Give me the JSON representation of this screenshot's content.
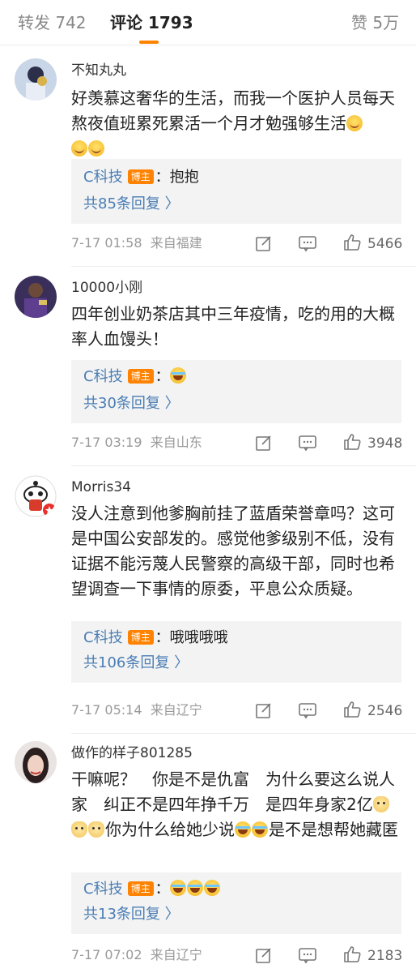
{
  "tabs": {
    "repost": "转发 742",
    "comments": "评论 1793",
    "likes": "赞 5万"
  },
  "accent_color": "#ff8200",
  "link_color": "#4a7db4",
  "comments": [
    {
      "username": "不知丸丸",
      "text": "好羡慕这奢华的生活，而我一个医护人员每天熬夜值班累死累活一个月才勉强够生活",
      "emoji": [
        "loudly-crying-face",
        "loudly-crying-face",
        "loudly-crying-face"
      ],
      "reply": {
        "author": "C科技",
        "badge": "博主",
        "text": "：抱抱",
        "count": "共85条回复 〉"
      },
      "time": "7-17 01:58",
      "location": "来自福建",
      "likes": "5466"
    },
    {
      "username": "10000小刚",
      "text": "四年创业奶茶店其中三年疫情，吃的用的大概率人血馒头！",
      "reply": {
        "author": "C科技",
        "badge": "博主",
        "text": "：",
        "emoji": [
          "laughing-crying-face"
        ],
        "count": "共30条回复 〉"
      },
      "time": "7-17 03:19",
      "location": "来自山东",
      "likes": "3948"
    },
    {
      "username": "Morris34",
      "text": "没人注意到他爹胸前挂了蓝盾荣誉章吗？这可是中国公安部发的。感觉他爹级别不低，没有证据不能污蔑人民警察的高级干部，同时也希望调查一下事情的原委，平息公众质疑。",
      "reply": {
        "author": "C科技",
        "badge": "博主",
        "text": "：哦哦哦哦",
        "count": "共106条回复 〉"
      },
      "time": "7-17 05:14",
      "location": "来自辽宁",
      "likes": "2546"
    },
    {
      "username": "做作的样子801285",
      "text_part1": "干嘛呢？　你是不是仇富　为什么要这么说人家　纠正不是四年挣千万　是四年身家2亿",
      "text_part2": "你为什么给她少说",
      "text_part3": "是不是想帮她藏匿",
      "emoji_a": [
        "dog-face",
        "dog-face",
        "dog-face"
      ],
      "emoji_b": [
        "laughing-crying-face",
        "laughing-crying-face"
      ],
      "reply": {
        "author": "C科技",
        "badge": "博主",
        "text": "：",
        "emoji": [
          "laughing-crying-face",
          "laughing-crying-face",
          "laughing-crying-face"
        ],
        "count": "共13条回复 〉"
      },
      "time": "7-17 07:02",
      "location": "来自辽宁",
      "likes": "2183"
    }
  ],
  "icons": {
    "repost": "share-edit-icon",
    "comment": "comment-bubble-icon",
    "like": "thumbs-up-icon"
  }
}
